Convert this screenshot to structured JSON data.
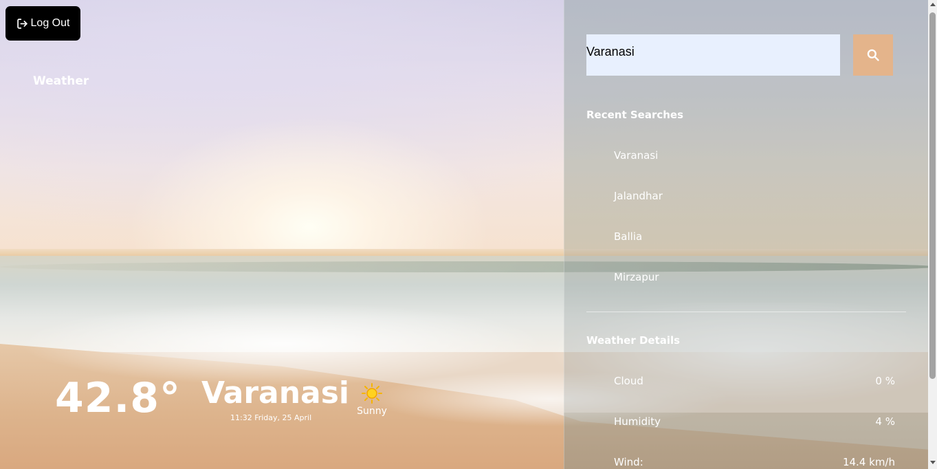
{
  "header": {
    "logout_label": "Log Out",
    "brand": "Weather"
  },
  "current": {
    "temperature": "42.8°",
    "city": "Varanasi",
    "datetime": "11:32 Friday, 25 April",
    "condition": "Sunny",
    "condition_icon": "sun-icon"
  },
  "search": {
    "value": "Varanasi",
    "button_icon": "search-icon"
  },
  "recent": {
    "title": "Recent Searches",
    "items": [
      "Varanasi",
      "Jalandhar",
      "Ballia",
      "Mirzapur"
    ]
  },
  "details": {
    "title": "Weather Details",
    "rows": [
      {
        "label": "Cloud",
        "value": "0 %"
      },
      {
        "label": "Humidity",
        "value": "4 %"
      },
      {
        "label": "Wind:",
        "value": "14.4 km/h"
      }
    ]
  },
  "colors": {
    "search_button": "#e4b48b",
    "search_input_bg": "#e8f0fe",
    "logout_bg": "#000000"
  }
}
